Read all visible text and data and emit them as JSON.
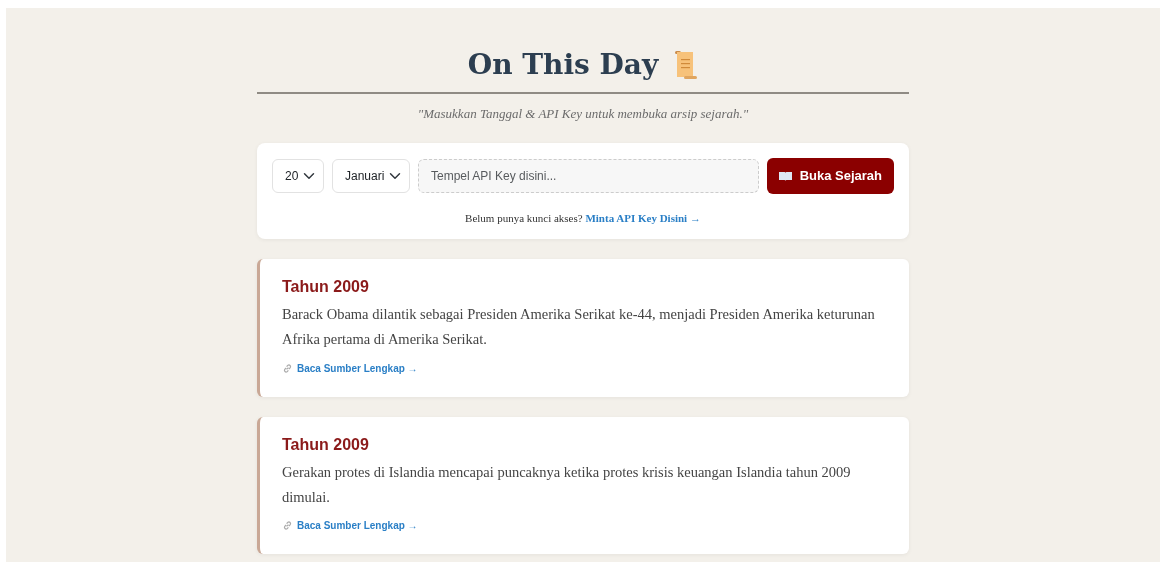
{
  "header": {
    "title": "On This Day",
    "subtitle": "\"Masukkan Tanggal & API Key untuk membuka arsip sejarah.\""
  },
  "form": {
    "day": "20",
    "month": "Januari",
    "api_key": {
      "placeholder": "Tempel API Key disini..."
    },
    "submit": "Buka Sejarah",
    "hint": "Belum punya kunci akses?",
    "hint_link": "Minta API Key Disini →"
  },
  "events": [
    {
      "year": "Tahun 2009",
      "text": "Barack Obama dilantik sebagai Presiden Amerika Serikat ke-44, menjadi Presiden Amerika keturunan Afrika pertama di Amerika Serikat.",
      "link": "Baca Sumber Lengkap →"
    },
    {
      "year": "Tahun 2009",
      "text": "Gerakan protes di Islandia mencapai puncaknya ketika protes krisis keuangan Islandia tahun 2009 dimulai.",
      "link": "Baca Sumber Lengkap →"
    }
  ]
}
